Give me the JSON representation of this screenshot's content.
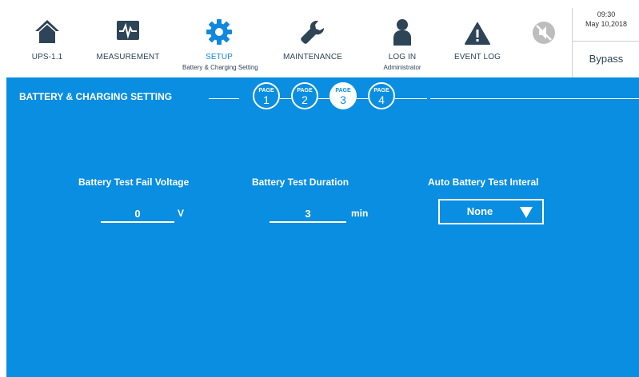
{
  "nav": {
    "items": [
      {
        "label": "UPS-1.1",
        "icon": "home-icon"
      },
      {
        "label": "MEASUREMENT",
        "icon": "measurement-icon"
      },
      {
        "label": "SETUP",
        "icon": "gear-icon",
        "sublabel": "Battery & Charging Setting",
        "active": true
      },
      {
        "label": "MAINTENANCE",
        "icon": "wrench-icon"
      },
      {
        "label": "LOG IN",
        "icon": "user-icon",
        "sublabel": "Administrator"
      },
      {
        "label": "EVENT LOG",
        "icon": "warning-icon"
      }
    ],
    "mute_icon": "mute-icon"
  },
  "status": {
    "time": "09:30",
    "date": "May 10,2018",
    "mode": "Bypass"
  },
  "section": {
    "title": "BATTERY & CHARGING SETTING"
  },
  "pages": {
    "word": "PAGE",
    "items": [
      "1",
      "2",
      "3",
      "4"
    ],
    "active": "3"
  },
  "fields": {
    "fail_voltage": {
      "label": "Battery Test Fail Voltage",
      "value": "0",
      "unit": "V"
    },
    "duration": {
      "label": "Battery Test Duration",
      "value": "3",
      "unit": "min"
    },
    "auto_interval": {
      "label": "Auto Battery Test Interal",
      "value": "None"
    }
  },
  "colors": {
    "panel": "#0a8ee1",
    "icon_dark": "#2e4457",
    "active_label": "#1188dd"
  }
}
